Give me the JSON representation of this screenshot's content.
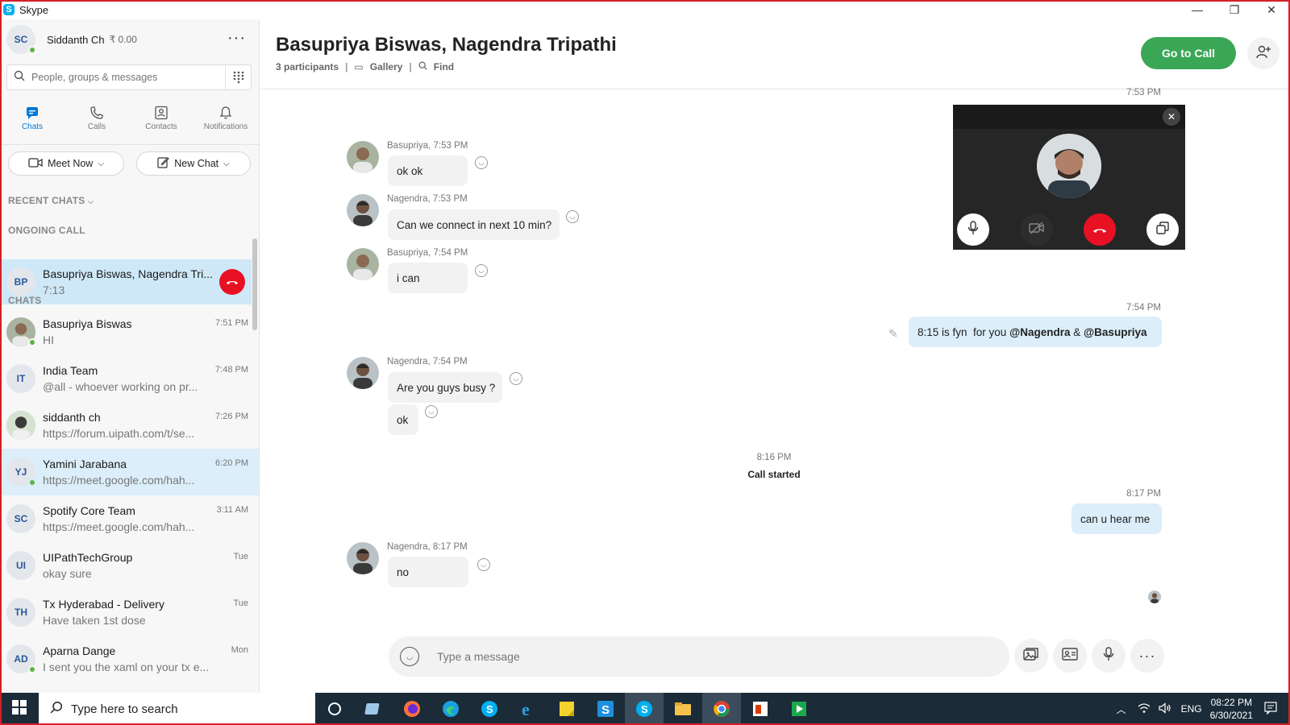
{
  "window": {
    "title": "Skype",
    "min": "—",
    "max": "❐",
    "close": "✕"
  },
  "profile": {
    "initials": "SC",
    "name": "Siddanth Ch",
    "credit": "₹ 0.00"
  },
  "search": {
    "placeholder": "People, groups & messages"
  },
  "nav": [
    {
      "label": "Chats",
      "icon": "chat-icon"
    },
    {
      "label": "Calls",
      "icon": "phone-icon"
    },
    {
      "label": "Contacts",
      "icon": "contacts-icon"
    },
    {
      "label": "Notifications",
      "icon": "bell-icon"
    }
  ],
  "actions": {
    "meet_now": "Meet Now",
    "new_chat": "New Chat"
  },
  "sections": {
    "recent": "RECENT CHATS",
    "ongoing": "ONGOING CALL",
    "chats": "CHATS"
  },
  "ongoing_call": {
    "initials": "BP",
    "name": "Basupriya Biswas, Nagendra Tri...",
    "duration": "7:13"
  },
  "chats": [
    {
      "initials": "",
      "name": "Basupriya Biswas",
      "preview": "HI",
      "time": "7:51 PM",
      "online": true,
      "highlight": false
    },
    {
      "initials": "IT",
      "name": "India Team",
      "preview": "@all - whoever working on pr...",
      "time": "7:48 PM",
      "online": false,
      "highlight": false
    },
    {
      "initials": "",
      "name": "siddanth ch",
      "preview": "https://forum.uipath.com/t/se...",
      "time": "7:26 PM",
      "online": false,
      "highlight": false
    },
    {
      "initials": "YJ",
      "name": "Yamini Jarabana",
      "preview": "https://meet.google.com/hah...",
      "time": "6:20 PM",
      "online": true,
      "highlight": true
    },
    {
      "initials": "SC",
      "name": "Spotify Core Team",
      "preview": "https://meet.google.com/hah...",
      "time": "3:11 AM",
      "online": false,
      "highlight": false
    },
    {
      "initials": "UI",
      "name": "UIPathTechGroup",
      "preview": "okay sure",
      "time": "Tue",
      "online": false,
      "highlight": false
    },
    {
      "initials": "TH",
      "name": "Tx Hyderabad - Delivery",
      "preview": "Have taken 1st dose",
      "time": "Tue",
      "online": false,
      "highlight": false
    },
    {
      "initials": "AD",
      "name": "Aparna Dange",
      "preview": "I sent you the xaml on your tx e...",
      "time": "Mon",
      "online": true,
      "highlight": false
    }
  ],
  "conversation": {
    "title": "Basupriya Biswas, Nagendra Tripathi",
    "participants": "3 participants",
    "gallery": "Gallery",
    "find": "Find",
    "go_to_call": "Go to Call",
    "top_time": "7:53 PM",
    "messages": [
      {
        "header": "Basupriya, 7:53 PM",
        "text": "ok ok"
      },
      {
        "header": "Nagendra, 7:53 PM",
        "text": "Can we connect in next 10 min?"
      },
      {
        "header": "Basupriya, 7:54 PM",
        "text": "i can"
      },
      {
        "header": "Nagendra, 7:54 PM",
        "text": "Are you guys busy ?"
      },
      {
        "text": "ok"
      },
      {
        "header": "Nagendra, 8:17 PM",
        "text": "no"
      }
    ],
    "sent": [
      {
        "time": "7:54 PM",
        "text_prefix": "8:15 is fyn  for you ",
        "mention1": "@Nagendra",
        "amp": " & ",
        "mention2": "@Basupriya"
      },
      {
        "time": "8:17 PM",
        "text": "can u hear me"
      }
    ],
    "system": {
      "time": "8:16 PM",
      "text": "Call started"
    },
    "composer_placeholder": "Type a message"
  },
  "taskbar": {
    "search_placeholder": "Type here to search",
    "lang": "ENG",
    "time": "08:22 PM",
    "date": "6/30/2021"
  },
  "colors": {
    "accent": "#0078d4",
    "call_green": "#3aa757",
    "end_red": "#e81123",
    "highlight": "#dbeefa"
  }
}
